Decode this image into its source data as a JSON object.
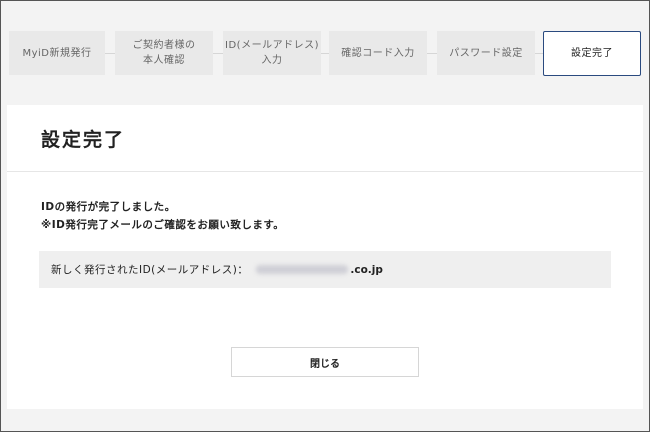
{
  "steps": [
    {
      "label": "MyiD新規発行",
      "active": false
    },
    {
      "label": "ご契約者様の\n本人確認",
      "active": false
    },
    {
      "label": "ID(メールアドレス)\n入力",
      "active": false
    },
    {
      "label": "確認コード入力",
      "active": false
    },
    {
      "label": "パスワード設定",
      "active": false
    },
    {
      "label": "設定完了",
      "active": true
    }
  ],
  "card": {
    "title": "設定完了",
    "message_line1": "IDの発行が完了しました。",
    "message_line2": "※ID発行完了メールのご確認をお願い致します。",
    "issued_id_label": "新しく発行されたID(メールアドレス)：",
    "issued_id_domain": ".co.jp",
    "close_button_label": "閉じる"
  },
  "colors": {
    "active_border": "#2a4a7f",
    "step_bg": "#e9e9e9",
    "page_bg": "#f3f3f3"
  }
}
